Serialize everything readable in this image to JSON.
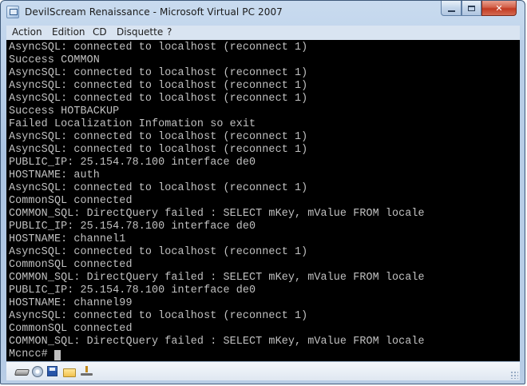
{
  "window": {
    "title": "DevilScream Renaissance - Microsoft Virtual PC 2007",
    "minimize_icon": "minimize-icon",
    "maximize_icon": "maximize-icon",
    "close_icon": "close-icon",
    "close_glyph": "✕"
  },
  "menu": {
    "items": [
      "Action",
      "Edition",
      "CD",
      "Disquette",
      "?"
    ]
  },
  "console": {
    "lines": [
      "AsyncSQL: connected to localhost (reconnect 1)",
      "Success COMMON",
      "AsyncSQL: connected to localhost (reconnect 1)",
      "AsyncSQL: connected to localhost (reconnect 1)",
      "AsyncSQL: connected to localhost (reconnect 1)",
      "Success HOTBACKUP",
      "Failed Localization Infomation so exit",
      "AsyncSQL: connected to localhost (reconnect 1)",
      "AsyncSQL: connected to localhost (reconnect 1)",
      "PUBLIC_IP: 25.154.78.100 interface de0",
      "HOSTNAME: auth",
      "AsyncSQL: connected to localhost (reconnect 1)",
      "CommonSQL connected",
      "COMMON_SQL: DirectQuery failed : SELECT mKey, mValue FROM locale",
      "PUBLIC_IP: 25.154.78.100 interface de0",
      "HOSTNAME: channel1",
      "AsyncSQL: connected to localhost (reconnect 1)",
      "CommonSQL connected",
      "COMMON_SQL: DirectQuery failed : SELECT mKey, mValue FROM locale",
      "PUBLIC_IP: 25.154.78.100 interface de0",
      "HOSTNAME: channel99",
      "AsyncSQL: connected to localhost (reconnect 1)",
      "CommonSQL connected",
      "COMMON_SQL: DirectQuery failed : SELECT mKey, mValue FROM locale"
    ],
    "prompt": "Mcncc#",
    "text_color": "#c0c0c0",
    "background": "#000000"
  },
  "statusbar": {
    "icons": [
      "hard-drive-icon",
      "cd-drive-icon",
      "floppy-disk-icon",
      "shared-folder-icon",
      "network-adapter-icon"
    ]
  }
}
